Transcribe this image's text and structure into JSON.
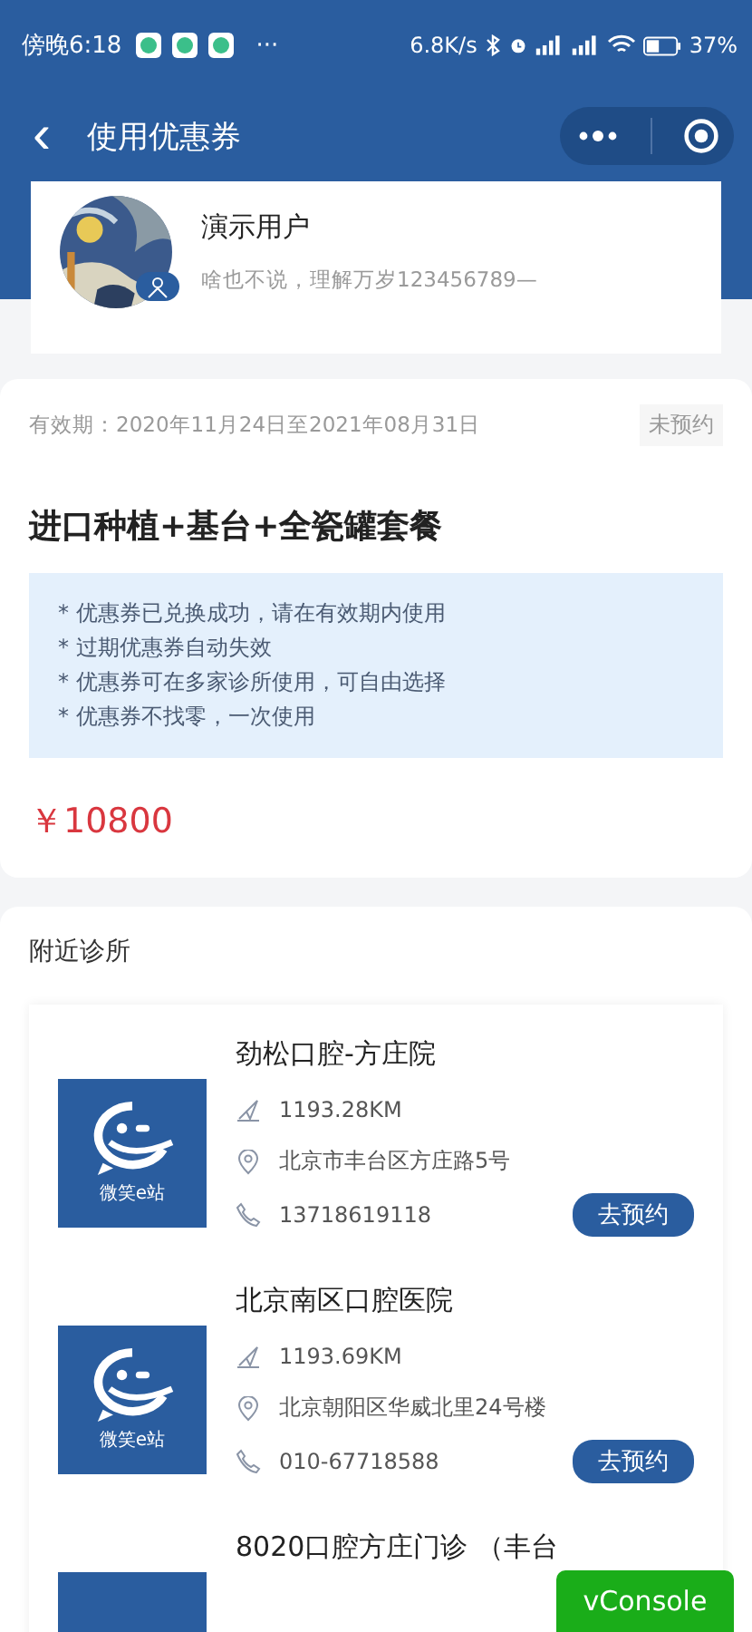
{
  "status_bar": {
    "time": "傍晚6:18",
    "more": "···",
    "speed": "6.8K/s",
    "battery": "37%"
  },
  "nav": {
    "back": "‹",
    "title": "使用优惠券"
  },
  "user": {
    "name": "演示用户",
    "bio": "啥也不说，理解万岁123456789—"
  },
  "coupon": {
    "validity": "有效期：2020年11月24日至2021年08月31日",
    "status": "未预约",
    "title": "进口种植+基台+全瓷罐套餐",
    "notes": [
      "* 优惠券已兑换成功，请在有效期内使用",
      "* 过期优惠券自动失效",
      "* 优惠券可在多家诊所使用，可自由选择",
      "* 优惠券不找零，一次使用"
    ],
    "price": "￥10800"
  },
  "nearby": {
    "title": "附近诊所",
    "clinics": [
      {
        "logo_text": "微笑e站",
        "name": "劲松口腔-方庄院",
        "distance": "1193.28KM",
        "address": "北京市丰台区方庄路5号",
        "phone": "13718619118",
        "button": "去预约"
      },
      {
        "logo_text": "微笑e站",
        "name": "北京南区口腔医院",
        "distance": "1193.69KM",
        "address": "北京朝阳区华威北里24号楼",
        "phone": "010-67718588",
        "button": "去预约"
      },
      {
        "name": "8020口腔方庄门诊 （丰台"
      }
    ]
  },
  "vconsole": "vConsole"
}
